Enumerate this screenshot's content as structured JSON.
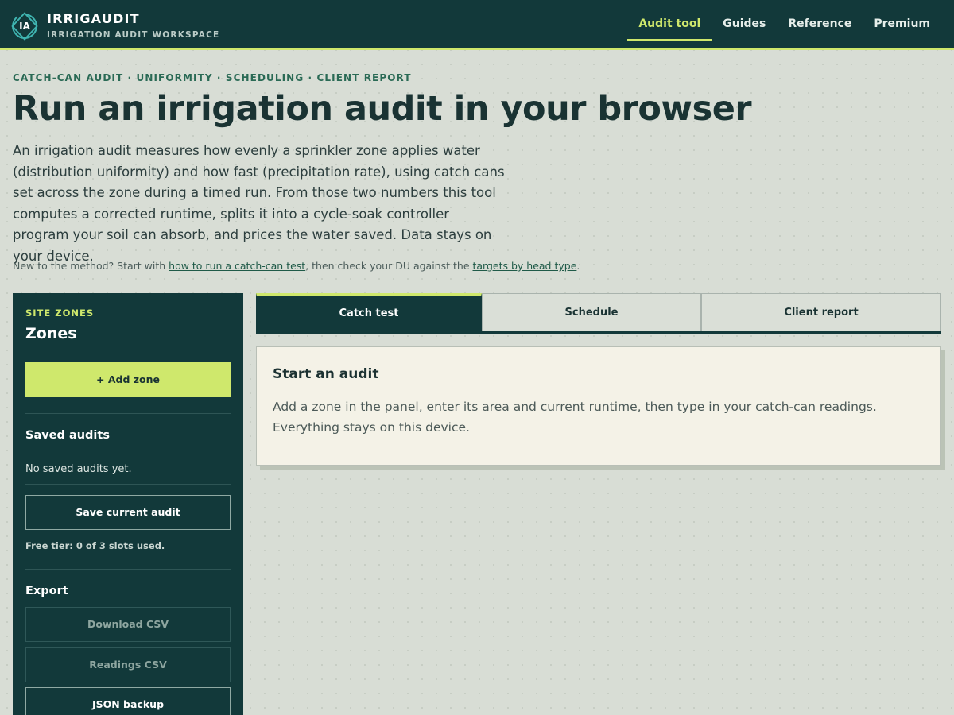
{
  "header": {
    "logo_initials": "IA",
    "brand_name": "IRRIGAUDIT",
    "brand_subtitle": "IRRIGATION AUDIT WORKSPACE",
    "nav": [
      {
        "label": "Audit tool",
        "active": true
      },
      {
        "label": "Guides",
        "active": false
      },
      {
        "label": "Reference",
        "active": false
      },
      {
        "label": "Premium",
        "active": false
      }
    ]
  },
  "hero": {
    "eyebrow": "CATCH-CAN AUDIT · UNIFORMITY · SCHEDULING · CLIENT REPORT",
    "title": "Run an irrigation audit in your browser",
    "description": "An irrigation audit measures how evenly a sprinkler zone applies water (distribution uniformity) and how fast (precipitation rate), using catch cans set across the zone during a timed run. From those two numbers this tool computes a corrected runtime, splits it into a cycle-soak controller program your soil can absorb, and prices the water saved. Data stays on your device.",
    "help_prefix": "New to the method? Start with ",
    "help_link_1": "how to run a catch-can test",
    "help_middle": ", then check your DU against the ",
    "help_link_2": "targets by head type",
    "help_suffix": "."
  },
  "sidebar": {
    "eyebrow": "SITE ZONES",
    "title": "Zones",
    "add_zone_label": "+ Add zone",
    "saved_heading": "Saved audits",
    "saved_empty": "No saved audits yet.",
    "save_button_label": "Save current audit",
    "tier_note": "Free tier: 0 of 3 slots used.",
    "export_heading": "Export",
    "export_buttons": [
      {
        "label": "Download CSV",
        "disabled": true
      },
      {
        "label": "Readings CSV",
        "disabled": true
      },
      {
        "label": "JSON backup",
        "disabled": false
      }
    ]
  },
  "tabs": [
    {
      "label": "Catch test",
      "active": true
    },
    {
      "label": "Schedule",
      "active": false
    },
    {
      "label": "Client report",
      "active": false
    }
  ],
  "card": {
    "title": "Start an audit",
    "body": "Add a zone in the panel, enter its area and current runtime, then type in your catch-can readings. Everything stays on this device."
  },
  "colors": {
    "primary_dark": "#12393a",
    "accent_lime": "#cfe86c",
    "page_bg": "#d8ddd5",
    "card_bg": "#f4f2e7"
  }
}
